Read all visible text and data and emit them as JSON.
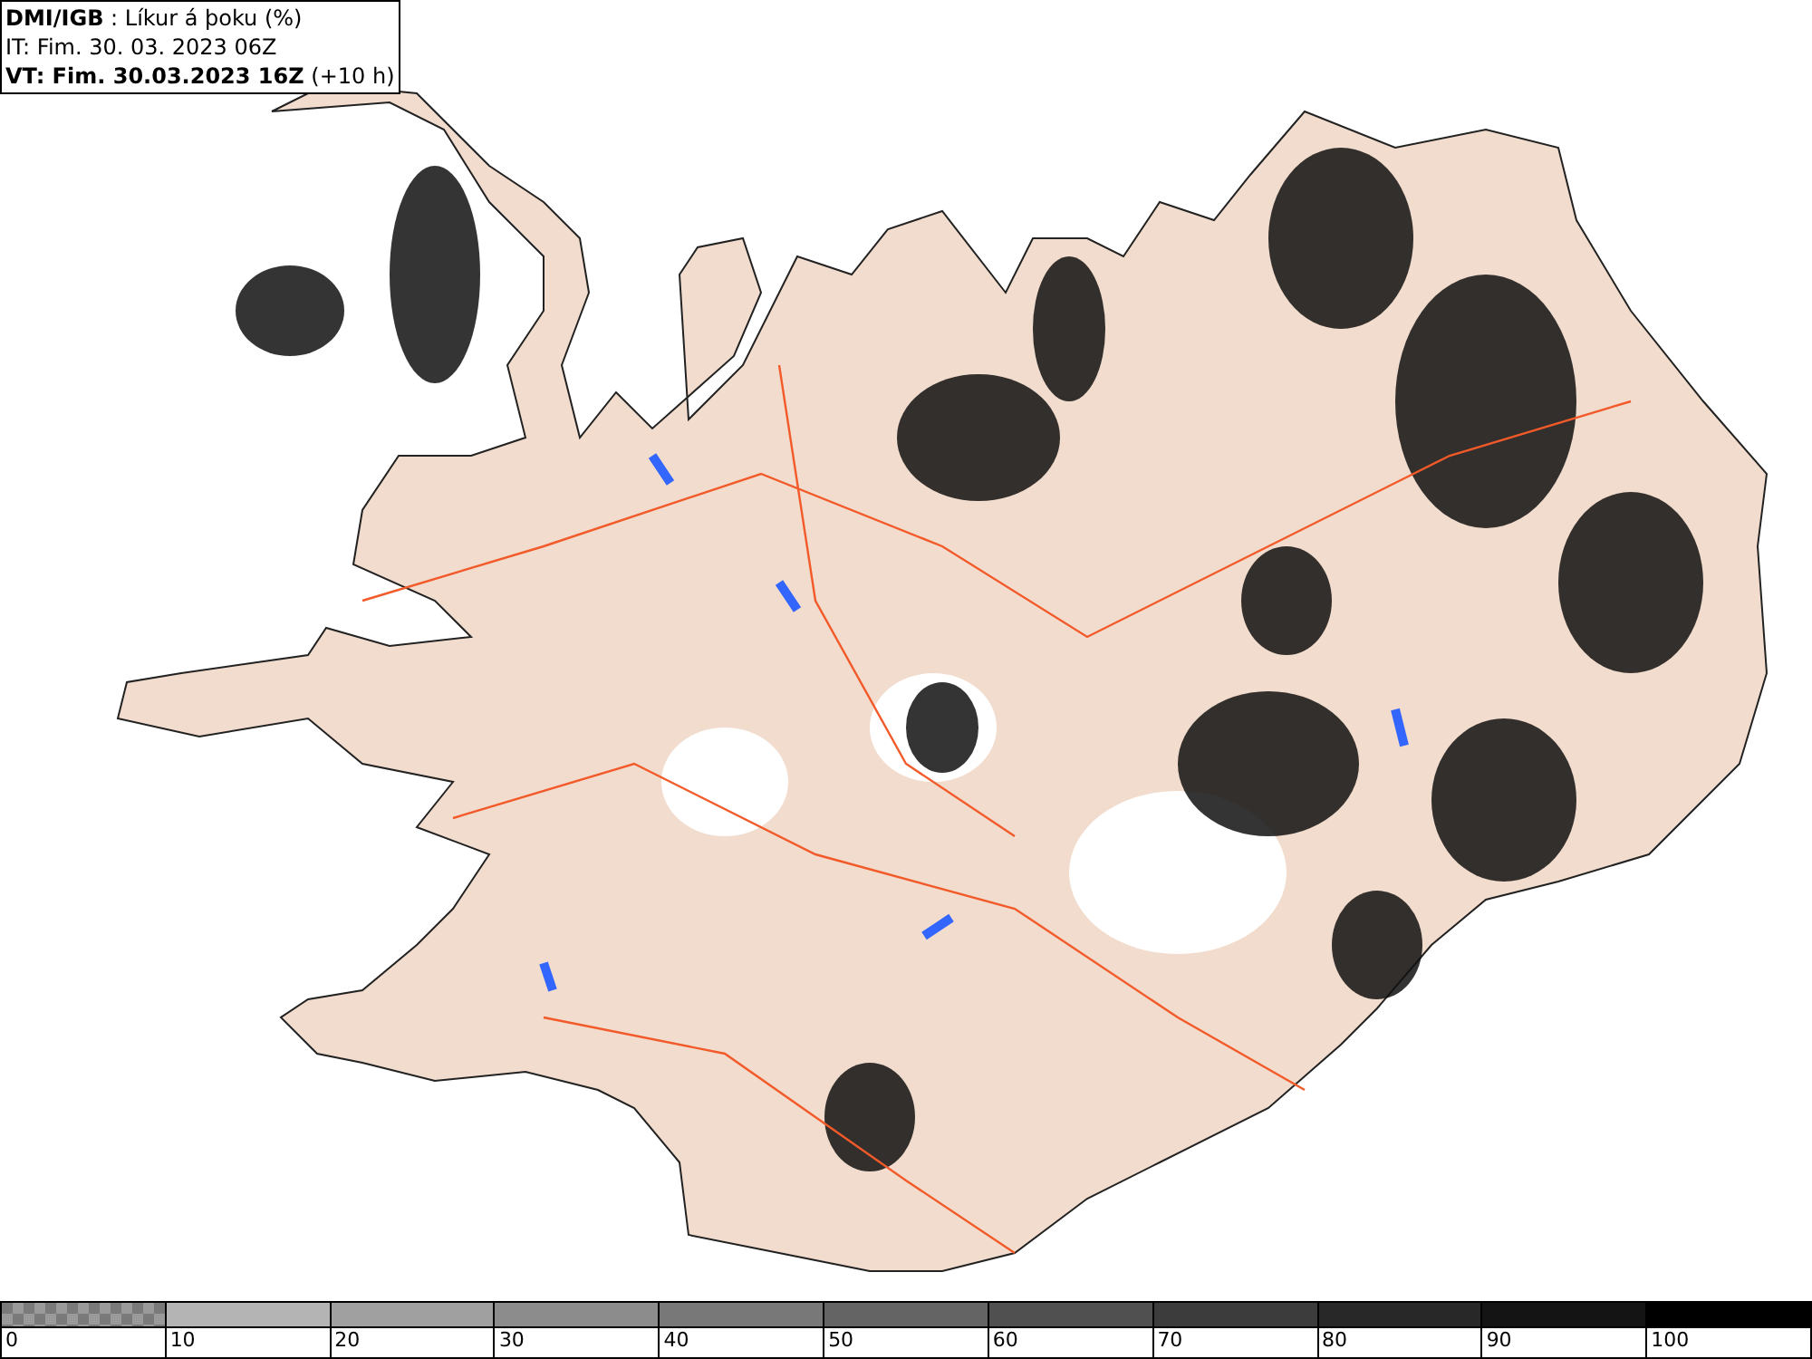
{
  "header": {
    "lines": [
      "**DMI/IGB** : Líkur á þoku (%)",
      "IT: Fim. 30. 03. 2023 06Z",
      "**VT: Fim. 30.03.2023 16Z** (+10 h)"
    ]
  },
  "legend": {
    "segments": [
      {
        "kind": "checker",
        "color": "#7a7a7a",
        "label": "0"
      },
      {
        "kind": "solid",
        "color": "#b4b4b4",
        "label": "10"
      },
      {
        "kind": "solid",
        "color": "#a0a0a0",
        "label": "20"
      },
      {
        "kind": "solid",
        "color": "#8c8c8c",
        "label": "30"
      },
      {
        "kind": "solid",
        "color": "#787878",
        "label": "40"
      },
      {
        "kind": "solid",
        "color": "#646464",
        "label": "50"
      },
      {
        "kind": "solid",
        "color": "#505050",
        "label": "60"
      },
      {
        "kind": "solid",
        "color": "#3c3c3c",
        "label": "70"
      },
      {
        "kind": "solid",
        "color": "#282828",
        "label": "80"
      },
      {
        "kind": "solid",
        "color": "#141414",
        "label": "90"
      },
      {
        "kind": "solid",
        "color": "#000000",
        "label": "100"
      }
    ]
  }
}
